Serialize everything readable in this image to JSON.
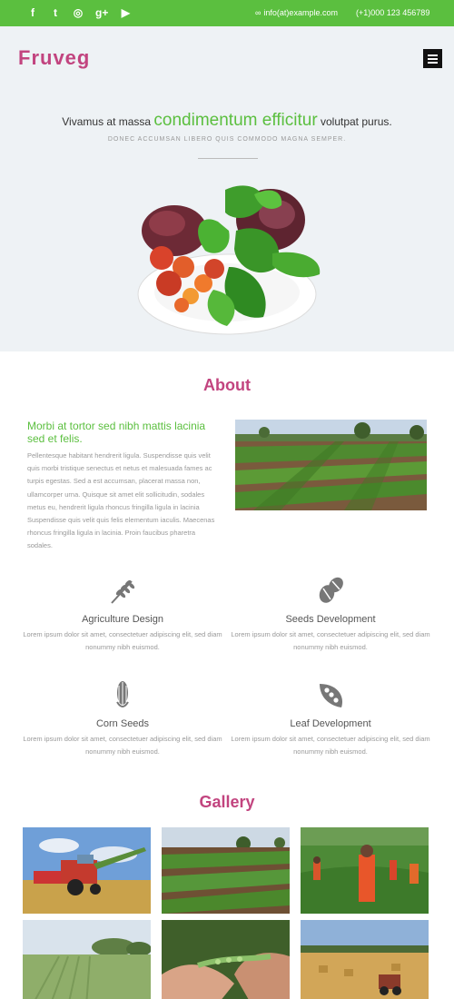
{
  "topbar": {
    "social": [
      {
        "icon": "facebook-icon",
        "glyph": "f"
      },
      {
        "icon": "twitter-icon",
        "glyph": "t"
      },
      {
        "icon": "dribbble-icon",
        "glyph": "◎"
      },
      {
        "icon": "google-plus-icon",
        "glyph": "g+"
      },
      {
        "icon": "youtube-icon",
        "glyph": "▶"
      }
    ],
    "email_icon": "∞",
    "email": "info(at)example.com",
    "phone": "(+1)000 123 456789"
  },
  "header": {
    "logo": "Fruveg",
    "menu_icon": "hamburger-menu-icon"
  },
  "hero": {
    "lead_before": "Vivamus at massa ",
    "lead_accent": "condimentum efficitur",
    "lead_after": " volutpat purus.",
    "subtitle": "DONEC ACCUMSAN LIBERO QUIS COMMODO MAGNA SEMPER."
  },
  "about": {
    "title": "About",
    "heading": "Morbi at tortor sed nibh mattis lacinia sed et felis.",
    "text": "Pellentesque habitant hendrerit ligula. Suspendisse quis velit quis morbi tristique senectus et netus et malesuada fames ac turpis egestas. Sed a est accumsan, placerat massa non, ullamcorper urna. Quisque sit amet elit sollicitudin, sodales metus eu, hendrerit ligula rhoncus fringilla ligula in lacinia Suspendisse quis velit quis felis elementum iaculis. Maecenas rhoncus fringilla ligula in lacinia. Proin faucibus pharetra sodales."
  },
  "features": [
    {
      "icon": "wheat-icon",
      "title": "Agriculture Design",
      "desc": "Lorem ipsum dolor sit amet, consectetuer adipiscing elit, sed diam nonummy nibh euismod."
    },
    {
      "icon": "seeds-icon",
      "title": "Seeds Development",
      "desc": "Lorem ipsum dolor sit amet, consectetuer adipiscing elit, sed diam nonummy nibh euismod."
    },
    {
      "icon": "corn-icon",
      "title": "Corn Seeds",
      "desc": "Lorem ipsum dolor sit amet, consectetuer adipiscing elit, sed diam nonummy nibh euismod."
    },
    {
      "icon": "pea-pod-icon",
      "title": "Leaf Development",
      "desc": "Lorem ipsum dolor sit amet, consectetuer adipiscing elit, sed diam nonummy nibh euismod."
    }
  ],
  "gallery": {
    "title": "Gallery"
  },
  "colors": {
    "accent_green": "#5bbf3f",
    "brand_pink": "#c2447f",
    "hero_bg": "#eef2f5"
  }
}
